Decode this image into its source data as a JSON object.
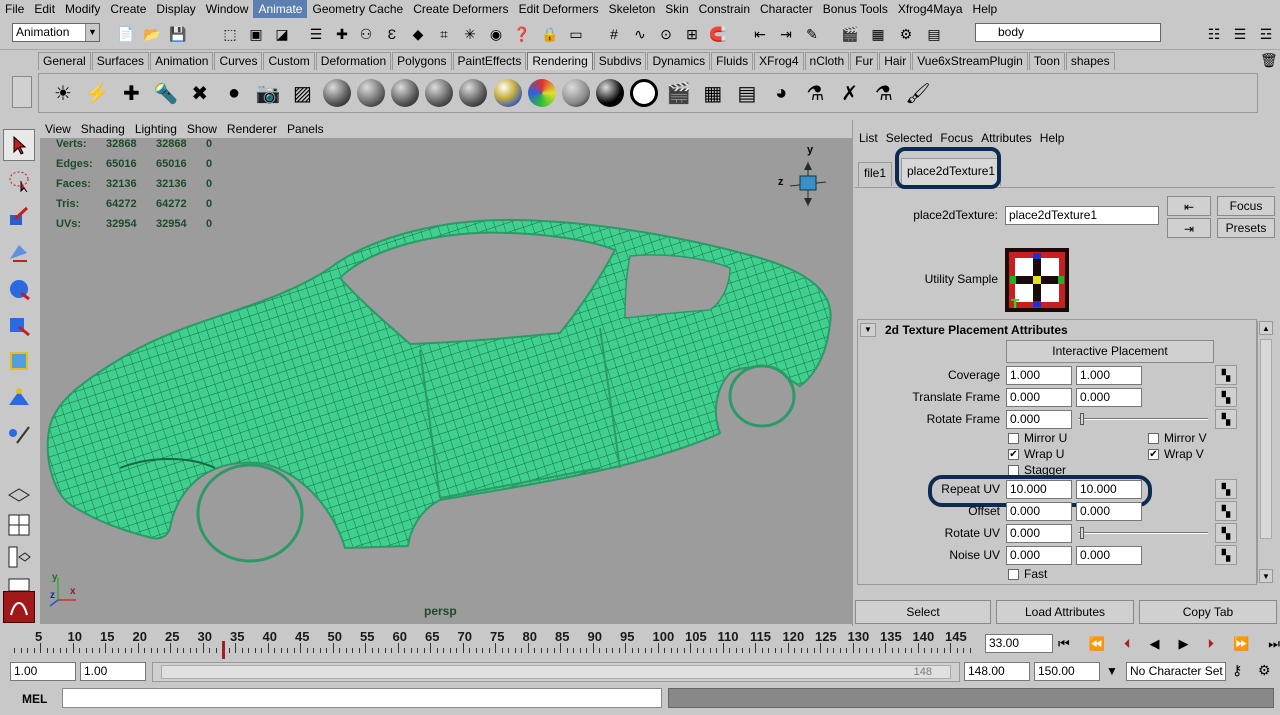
{
  "menubar": {
    "items": [
      "File",
      "Edit",
      "Modify",
      "Create",
      "Display",
      "Window",
      "Animate",
      "Geometry Cache",
      "Create Deformers",
      "Edit Deformers",
      "Skeleton",
      "Skin",
      "Constrain",
      "Character",
      "Bonus Tools",
      "Xfrog4Maya",
      "Help"
    ],
    "active": "Animate"
  },
  "statusline": {
    "menu_set": "Animation",
    "selection_field": "body"
  },
  "shelf": {
    "tabs": [
      "General",
      "Surfaces",
      "Animation",
      "Curves",
      "Custom",
      "Deformation",
      "Polygons",
      "PaintEffects",
      "Rendering",
      "Subdivs",
      "Dynamics",
      "Fluids",
      "XFrog4",
      "nCloth",
      "Fur",
      "Hair",
      "Vue6xStreamPlugin",
      "Toon",
      "shapes"
    ],
    "selected": "Rendering",
    "icons": [
      "ambient-light-icon",
      "directional-light-icon",
      "point-light-icon",
      "spot-light-icon",
      "area-light-icon",
      "volume-light-icon",
      "camera-icon",
      "create-render-node-icon",
      "blinn-sphere-icon",
      "phong-sphere-icon",
      "phonge-sphere-icon",
      "lambert-sphere-icon",
      "anisotropic-sphere-icon",
      "ramp-shader-icon",
      "layered-shader-icon",
      "gray-sphere-icon",
      "black-sphere-icon",
      "ring-sphere-icon",
      "render-settings-icon",
      "ipr-render-icon",
      "render-view-icon",
      "hypershade-icon",
      "mental-ray-icon",
      "paint-icon",
      "pv-icon",
      "paint-brush-icon"
    ]
  },
  "viewport": {
    "menu": [
      "View",
      "Shading",
      "Lighting",
      "Show",
      "Renderer",
      "Panels"
    ],
    "hud": [
      {
        "label": "Verts:",
        "a": "32868",
        "b": "32868",
        "c": "0"
      },
      {
        "label": "Edges:",
        "a": "65016",
        "b": "65016",
        "c": "0"
      },
      {
        "label": "Faces:",
        "a": "32136",
        "b": "32136",
        "c": "0"
      },
      {
        "label": "Tris:",
        "a": "64272",
        "b": "64272",
        "c": "0"
      },
      {
        "label": "UVs:",
        "a": "32954",
        "b": "32954",
        "c": "0"
      }
    ],
    "camera_label": "persp",
    "axis": {
      "x": "x",
      "y": "y",
      "z": "z"
    },
    "wire_color": "#4de8a0"
  },
  "attribute_editor": {
    "menu": [
      "List",
      "Selected",
      "Focus",
      "Attributes",
      "Help"
    ],
    "tabs": [
      "file1",
      "place2dTexture1"
    ],
    "node_label": "place2dTexture:",
    "node_name": "place2dTexture1",
    "focus_label": "Focus",
    "presets_label": "Presets",
    "utility_label": "Utility Sample",
    "section_title": "2d Texture Placement Attributes",
    "interactive_label": "Interactive Placement",
    "rows": {
      "coverage": {
        "label": "Coverage",
        "a": "1.000",
        "b": "1.000"
      },
      "translate": {
        "label": "Translate Frame",
        "a": "0.000",
        "b": "0.000"
      },
      "rotate": {
        "label": "Rotate Frame",
        "a": "0.000"
      },
      "repeat": {
        "label": "Repeat UV",
        "a": "10.000",
        "b": "10.000"
      },
      "offset": {
        "label": "Offset",
        "a": "0.000",
        "b": "0.000"
      },
      "rotate_uv": {
        "label": "Rotate UV",
        "a": "0.000"
      },
      "noise": {
        "label": "Noise UV",
        "a": "0.000",
        "b": "0.000"
      }
    },
    "checks": {
      "mirror_u": {
        "label": "Mirror U",
        "checked": false
      },
      "mirror_v": {
        "label": "Mirror V",
        "checked": false
      },
      "wrap_u": {
        "label": "Wrap U",
        "checked": true
      },
      "wrap_v": {
        "label": "Wrap V",
        "checked": true
      },
      "stagger": {
        "label": "Stagger",
        "checked": false
      },
      "fast": {
        "label": "Fast",
        "checked": false
      }
    },
    "bottom_buttons": [
      "Select",
      "Load Attributes",
      "Copy Tab"
    ],
    "highlight_color": "#0d2b52"
  },
  "timeslider": {
    "ticks": [
      "5",
      "10",
      "15",
      "20",
      "25",
      "30",
      "35",
      "40",
      "45",
      "50",
      "55",
      "60",
      "65",
      "70",
      "75",
      "80",
      "85",
      "90",
      "95",
      "100",
      "105",
      "110",
      "115",
      "120",
      "125",
      "130",
      "135",
      "140",
      "145"
    ],
    "current_frame": "33.00"
  },
  "range": {
    "start": "1.00",
    "anim_start": "1.00",
    "slider_end": "148",
    "end": "148.00",
    "anim_end": "150.00",
    "character_set": "No Character Set"
  },
  "cmdline": {
    "label": "MEL"
  }
}
